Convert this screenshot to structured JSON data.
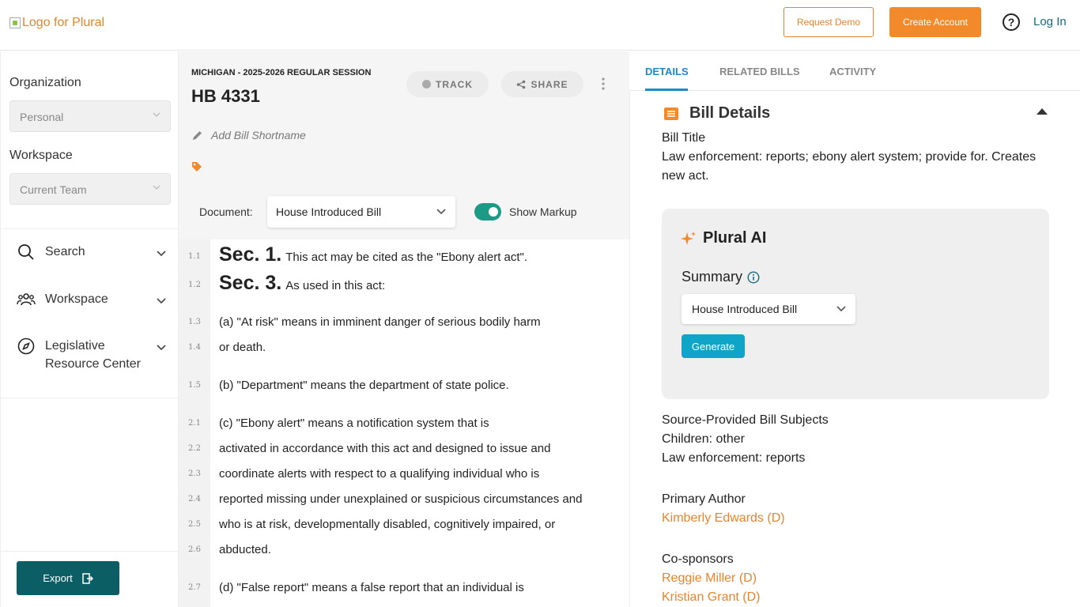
{
  "header": {
    "logo_alt": "Logo for Plural",
    "request_demo": "Request Demo",
    "create_account": "Create Account",
    "help": "?",
    "login": "Log In"
  },
  "sidebar": {
    "organization_label": "Organization",
    "organization_value": "Personal",
    "workspace_label": "Workspace",
    "workspace_value": "Current Team",
    "nav": [
      {
        "label": "Search",
        "icon": "search-icon"
      },
      {
        "label": "Workspace",
        "icon": "people-icon"
      },
      {
        "label": "Legislative Resource Center",
        "icon": "compass-icon"
      }
    ],
    "export": "Export"
  },
  "bill": {
    "session": "MICHIGAN - 2025-2026 REGULAR SESSION",
    "number": "HB 4331",
    "track": "TRACK",
    "share": "SHARE",
    "shortname_placeholder": "Add Bill Shortname",
    "document_label": "Document:",
    "document_value": "House Introduced Bill",
    "show_markup": "Show Markup"
  },
  "document_lines": [
    {
      "ln": "1.1",
      "sec": "Sec. 1.",
      "text": "This act may be cited as the \"Ebony alert act\"."
    },
    {
      "ln": "1.2",
      "sec": "Sec. 3.",
      "text": "As used in this act:"
    },
    {
      "ln": "1.3",
      "sec": "",
      "text": "(a) \"At risk\" means in imminent danger of serious bodily harm"
    },
    {
      "ln": "1.4",
      "sec": "",
      "text": "or death."
    },
    {
      "ln": "1.5",
      "sec": "",
      "text": "(b) \"Department\" means the department of state police."
    },
    {
      "ln": "2.1",
      "sec": "",
      "text": "(c) \"Ebony alert\" means a notification system that is"
    },
    {
      "ln": "2.2",
      "sec": "",
      "text": "activated in accordance with this act and designed to issue and"
    },
    {
      "ln": "2.3",
      "sec": "",
      "text": "coordinate alerts with respect to a qualifying individual who is"
    },
    {
      "ln": "2.4",
      "sec": "",
      "text": "reported missing under unexplained or suspicious circumstances and"
    },
    {
      "ln": "2.5",
      "sec": "",
      "text": "who is at risk, developmentally disabled, cognitively impaired, or"
    },
    {
      "ln": "2.6",
      "sec": "",
      "text": "abducted."
    },
    {
      "ln": "2.7",
      "sec": "",
      "text": "(d) \"False report\" means a false report that an individual is"
    }
  ],
  "right": {
    "tabs": [
      "DETAILS",
      "RELATED BILLS",
      "ACTIVITY"
    ],
    "bill_details_heading": "Bill Details",
    "bill_title_label": "Bill Title",
    "bill_title_line1": "Law enforcement: reports; ebony alert system; provide for. Creates",
    "bill_title_line2": "new act.",
    "ai": {
      "title": "Plural AI",
      "summary_label": "Summary",
      "select_value": "House Introduced Bill",
      "generate": "Generate"
    },
    "subjects_label": "Source-Provided Bill Subjects",
    "subjects": [
      "Children: other",
      "Law enforcement: reports"
    ],
    "primary_author_label": "Primary Author",
    "primary_author": "Kimberly Edwards (D)",
    "cosponsors_label": "Co-sponsors",
    "cosponsors": [
      "Reggie Miller (D)",
      "Kristian Grant (D)"
    ]
  },
  "colors": {
    "accent_orange": "#f28a2b",
    "link_blue": "#1e88c8",
    "teal": "#0b5e63",
    "toggle_green": "#1d9a85",
    "generate_blue": "#0ea5c8"
  }
}
